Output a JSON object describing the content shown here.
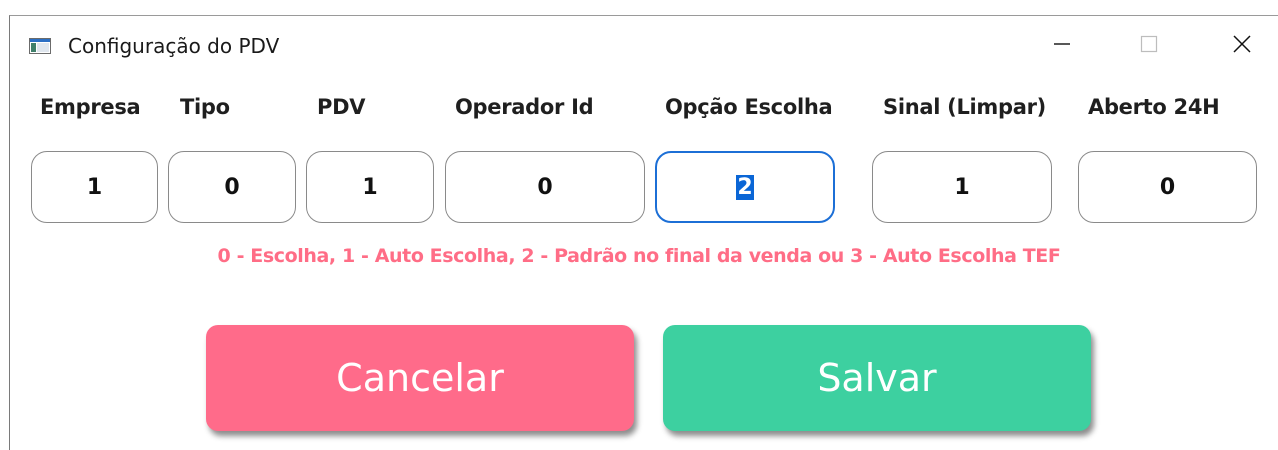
{
  "window": {
    "title": "Configuração do PDV",
    "controls": {
      "minimize": "minimize-icon",
      "maximize": "maximize-icon",
      "close": "close-icon"
    }
  },
  "fields": [
    {
      "label": "Empresa",
      "value": "1"
    },
    {
      "label": "Tipo",
      "value": "0"
    },
    {
      "label": "PDV",
      "value": "1"
    },
    {
      "label": "Operador Id",
      "value": "0"
    },
    {
      "label": "Opção Escolha",
      "value": "2",
      "focused": true,
      "selected": true
    },
    {
      "label": "Sinal (Limpar)",
      "value": "1"
    },
    {
      "label": "Aberto 24H",
      "value": "0"
    }
  ],
  "hint": "0 - Escolha, 1 - Auto Escolha, 2 - Padrão no final da venda ou 3 - Auto Escolha TEF",
  "buttons": {
    "cancel": "Cancelar",
    "save": "Salvar"
  },
  "colors": {
    "hint": "#ff6d86",
    "cancel": "#ff6b8a",
    "save": "#3dd0a0",
    "focus_border": "#1c6fd6",
    "selection": "#0a66d6"
  }
}
